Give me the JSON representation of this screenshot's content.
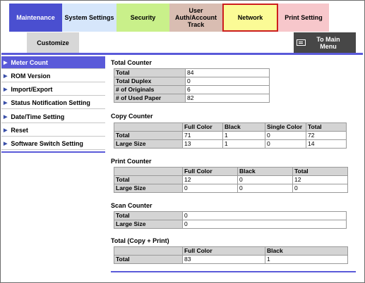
{
  "tabs": {
    "maintenance": "Maintenance",
    "system_settings": "System Settings",
    "security": "Security",
    "user_auth": "User Auth/Account Track",
    "network": "Network",
    "print_setting": "Print Setting",
    "customize": "Customize",
    "to_main_menu": "To Main Menu"
  },
  "sidebar": {
    "items": [
      {
        "label": "Meter Count"
      },
      {
        "label": "ROM Version"
      },
      {
        "label": "Import/Export"
      },
      {
        "label": "Status Notification Setting"
      },
      {
        "label": "Date/Time Setting"
      },
      {
        "label": "Reset"
      },
      {
        "label": "Software Switch Setting"
      }
    ]
  },
  "total_counter": {
    "title": "Total Counter",
    "rows": [
      {
        "label": "Total",
        "value": "84"
      },
      {
        "label": "Total Duplex",
        "value": "0"
      },
      {
        "label": "# of Originals",
        "value": "6"
      },
      {
        "label": "# of Used Paper",
        "value": "82"
      }
    ]
  },
  "copy_counter": {
    "title": "Copy Counter",
    "headers": [
      "Full Color",
      "Black",
      "Single Color",
      "Total"
    ],
    "rows": [
      {
        "label": "Total",
        "values": [
          "71",
          "1",
          "0",
          "72"
        ]
      },
      {
        "label": "Large Size",
        "values": [
          "13",
          "1",
          "0",
          "14"
        ]
      }
    ]
  },
  "print_counter": {
    "title": "Print Counter",
    "headers": [
      "Full Color",
      "Black",
      "Total"
    ],
    "rows": [
      {
        "label": "Total",
        "values": [
          "12",
          "0",
          "12"
        ]
      },
      {
        "label": "Large Size",
        "values": [
          "0",
          "0",
          "0"
        ]
      }
    ]
  },
  "scan_counter": {
    "title": "Scan Counter",
    "rows": [
      {
        "label": "Total",
        "value": "0"
      },
      {
        "label": "Large Size",
        "value": "0"
      }
    ]
  },
  "total_copy_print": {
    "title": "Total (Copy + Print)",
    "headers": [
      "Full Color",
      "Black"
    ],
    "rows": [
      {
        "label": "Total",
        "values": [
          "83",
          "1"
        ]
      }
    ]
  },
  "colors": {
    "accent": "#5a5ad9",
    "maintenance_tab": "#4a4fd0",
    "system_settings_tab": "#d6e6fb",
    "security_tab": "#c9f08a",
    "user_auth_tab": "#d9bdb2",
    "network_tab": "#fbfb96",
    "network_border": "#cc1e1e",
    "print_setting_tab": "#f7c7cb",
    "customize_tab": "#d7d7d7",
    "main_menu_button": "#474747"
  }
}
